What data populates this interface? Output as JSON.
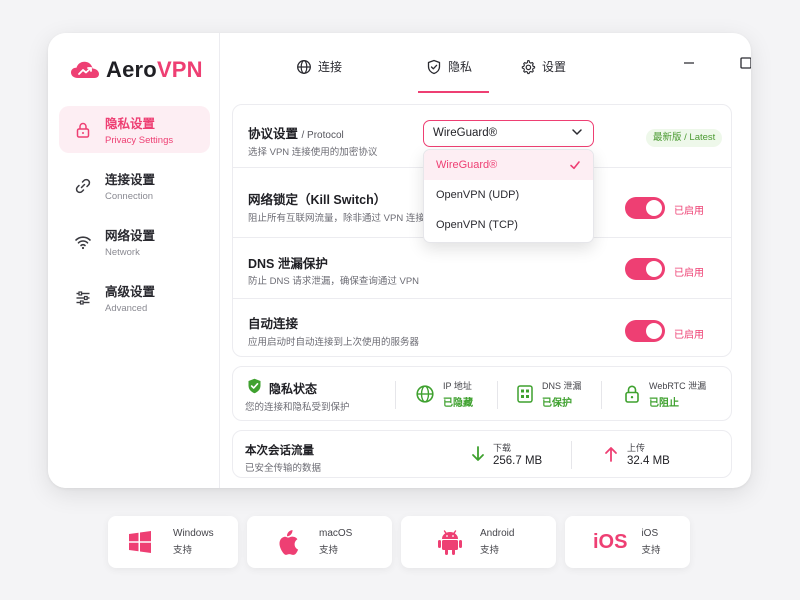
{
  "app": {
    "logo_aero": "Aero",
    "logo_vpn": "VPN"
  },
  "colors": {
    "accent": "#ee3f73",
    "success": "#3fa12f",
    "badge_bg": "#eef8ea"
  },
  "sidebar": {
    "items": [
      {
        "cn": "隐私设置",
        "en": "Privacy Settings",
        "icon": "lock-icon",
        "active": true
      },
      {
        "cn": "连接设置",
        "en": "Connection",
        "icon": "link-icon",
        "active": false
      },
      {
        "cn": "网络设置",
        "en": "Network",
        "icon": "wifi-icon",
        "active": false
      },
      {
        "cn": "高级设置",
        "en": "Advanced",
        "icon": "sliders-icon",
        "active": false
      }
    ]
  },
  "tabs": [
    {
      "label": "连接",
      "icon": "globe-icon",
      "active": false
    },
    {
      "label": "隐私",
      "icon": "shield-icon",
      "active": true
    },
    {
      "label": "设置",
      "icon": "gear-icon",
      "active": false
    }
  ],
  "window_controls": [
    "minimize-icon",
    "maximize-icon",
    "close-icon"
  ],
  "protocol": {
    "title": "协议设置",
    "title_en": "/ Protocol",
    "desc": "选择 VPN 连接使用的加密协议",
    "selected": "WireGuard®",
    "badge": "最新版 / Latest",
    "options": [
      "WireGuard®",
      "OpenVPN (UDP)",
      "OpenVPN (TCP)"
    ]
  },
  "settings": [
    {
      "title": "网络锁定（Kill Switch）",
      "desc": "阻止所有互联网流量，除非通过 VPN 连接",
      "status": "已启用",
      "on": true
    },
    {
      "title": "DNS 泄漏保护",
      "desc": "防止 DNS 请求泄漏，确保查询通过 VPN",
      "status": "已启用",
      "on": true
    },
    {
      "title": "自动连接",
      "desc": "应用启动时自动连接到上次使用的服务器",
      "status": "已启用",
      "on": true
    }
  ],
  "privacy_status": {
    "title": "隐私状态",
    "desc": "您的连接和隐私受到保护",
    "items": [
      {
        "label": "IP 地址",
        "value": "已隐藏",
        "icon": "globe-icon"
      },
      {
        "label": "DNS 泄漏",
        "value": "已保护",
        "icon": "dns-icon"
      },
      {
        "label": "WebRTC 泄漏",
        "value": "已阻止",
        "icon": "lock-icon"
      }
    ]
  },
  "traffic": {
    "title": "本次会话流量",
    "desc": "已安全传输的数据",
    "download_label": "下载",
    "download_value": "256.7 MB",
    "upload_label": "上传",
    "upload_value": "32.4 MB"
  },
  "platforms": [
    {
      "name": "Windows",
      "sub": "支持",
      "icon": "windows-icon"
    },
    {
      "name": "macOS",
      "sub": "支持",
      "icon": "apple-icon"
    },
    {
      "name": "Android",
      "sub": "支持",
      "icon": "android-icon"
    },
    {
      "name": "iOS",
      "sub": "支持",
      "icon": "ios-icon",
      "icon_text": "iOS"
    }
  ]
}
